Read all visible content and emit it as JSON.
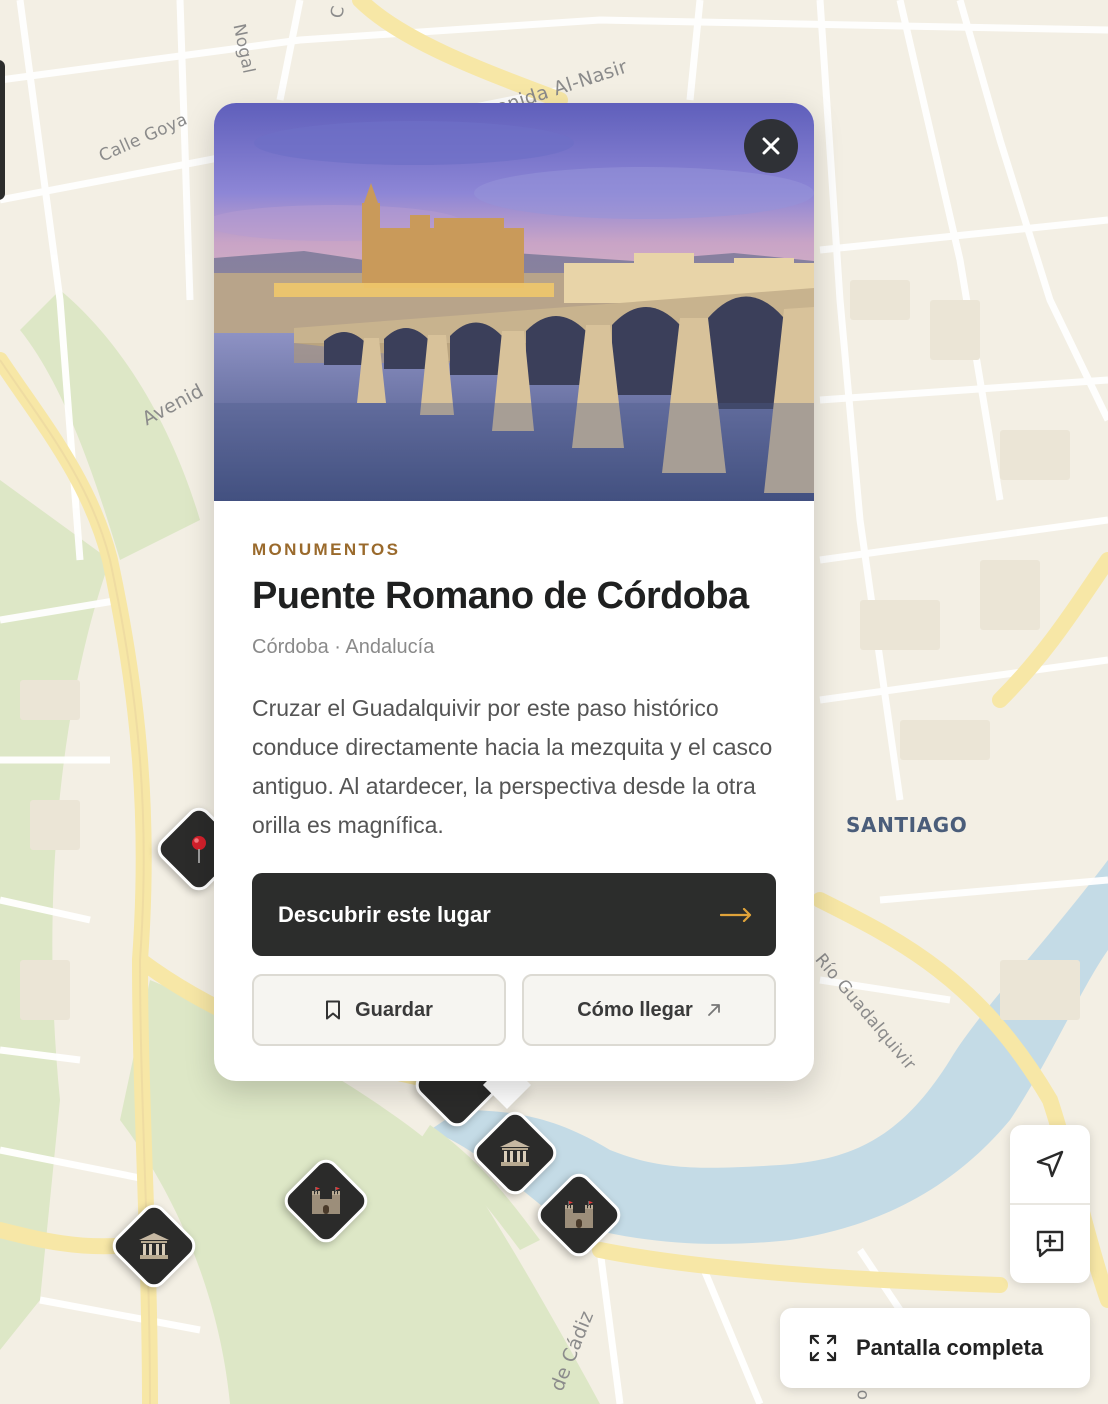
{
  "map": {
    "street_labels": [
      "Nogal",
      "C",
      "Avenida Al-Nasir",
      "Calle Goya",
      "Avenid",
      "Río Guadalquivir",
      "de Cádiz",
      "o"
    ],
    "district_label": "SANTIAGO",
    "colors": {
      "land": "#f3efe4",
      "roads": "#ffffff",
      "major_roads": "#f7e7a6",
      "water": "#c4dbe6",
      "parks": "#dde7c6"
    }
  },
  "markers": [
    {
      "name": "pin-marker",
      "icon": "map-pin-icon"
    },
    {
      "name": "monument-marker",
      "icon": "classical-building-icon"
    },
    {
      "name": "monument-marker",
      "icon": "classical-building-icon"
    },
    {
      "name": "castle-marker",
      "icon": "castle-icon"
    },
    {
      "name": "castle-marker",
      "icon": "castle-icon"
    }
  ],
  "popup": {
    "image_alt": "Puente Romano de Córdoba",
    "category": "MONUMENTOS",
    "title": "Puente Romano de Córdoba",
    "location": "Córdoba · Andalucía",
    "description": "Cruzar el Guadalquivir por este paso histórico conduce directamente hacia la mezquita y el casco antiguo. Al atardecer, la perspectiva desde la otra orilla es magnífica.",
    "primary_button": {
      "label": "Descubrir este lugar",
      "icon": "arrow-right-icon"
    },
    "save_button": {
      "label": "Guardar",
      "icon": "bookmark-icon"
    },
    "directions_button": {
      "label": "Cómo llegar",
      "icon": "external-arrow-icon"
    },
    "close_icon": "close-icon",
    "colors": {
      "category": "#9a6a2c",
      "primary_bg": "#2c2d2c",
      "arrow": "#e0a33a"
    }
  },
  "controls": {
    "locate_icon": "navigation-arrow-icon",
    "feedback_icon": "message-plus-icon",
    "fullscreen": {
      "label": "Pantalla completa",
      "icon": "expand-icon"
    }
  }
}
